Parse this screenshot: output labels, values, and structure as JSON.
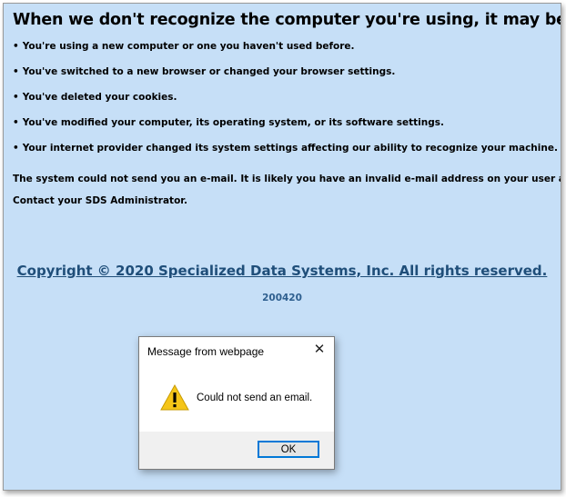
{
  "page": {
    "heading": "When we don't recognize the computer you're using, it may be because:",
    "bullet_char": "•",
    "reasons": [
      "You're using a new computer or one you haven't used before.",
      "You've switched to a new browser or changed your browser settings.",
      "You've deleted your cookies.",
      "You've modified your computer, its operating system, or its software settings.",
      "Your internet provider changed its system settings affecting our ability to recognize your machine."
    ],
    "notice": "The system could not send you an e-mail. It is likely you have an invalid e-mail address on your user account.",
    "contact": "Contact your SDS Administrator.",
    "copyright": "Copyright © 2020 Specialized Data Systems, Inc. All rights reserved.",
    "build": "200420"
  },
  "dialog": {
    "title": "Message from webpage",
    "close_glyph": "✕",
    "icon": "warning-icon",
    "message": "Could not send an email.",
    "ok_label": "OK"
  },
  "colors": {
    "background": "#c6dff7",
    "link": "#1f4e79",
    "build": "#2e5f8f",
    "warning": "#f5c518",
    "button_focus": "#0078d7"
  }
}
